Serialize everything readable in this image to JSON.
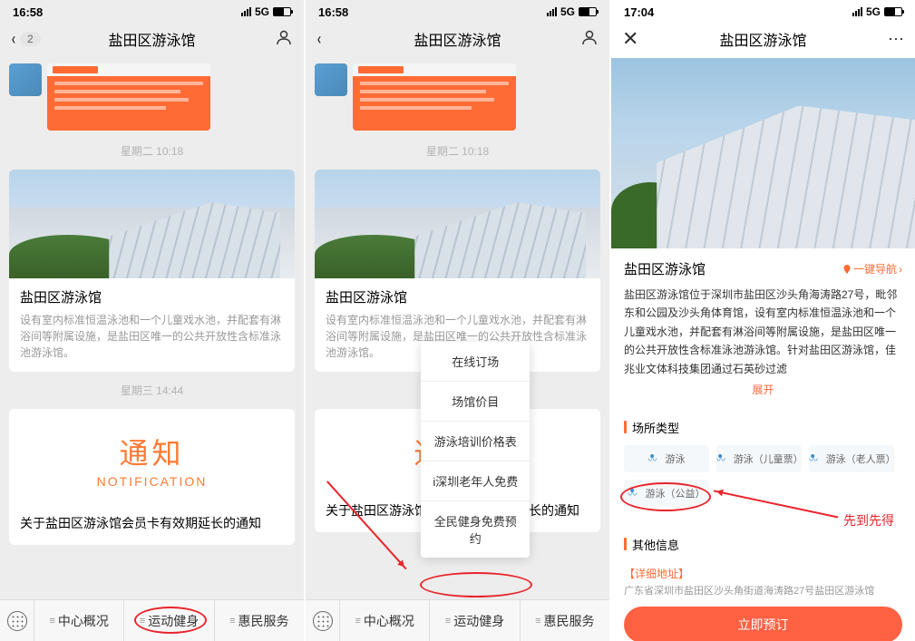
{
  "status": {
    "time1": "16:58",
    "time2": "16:58",
    "time3": "17:04",
    "net": "5G"
  },
  "nav": {
    "title": "盐田区游泳馆",
    "back_count": "2"
  },
  "timestamps": {
    "ts1": "星期二 10:18",
    "ts2": "星期三 14:44"
  },
  "article": {
    "title": "盐田区游泳馆",
    "desc": "设有室内标准恒温泳池和一个儿童戏水池，并配套有淋浴间等附属设施，是盐田区唯一的公共开放性含标准泳池游泳馆。"
  },
  "notice": {
    "cn": "通知",
    "en": "NOTIFICATION",
    "text": "关于盐田区游泳馆会员卡有效期延长的通知"
  },
  "tabs": {
    "t1": "中心概况",
    "t2": "运动健身",
    "t3": "惠民服务"
  },
  "popup": {
    "i1": "在线订场",
    "i2": "场馆价目",
    "i3": "游泳培训价格表",
    "i4": "i深圳老年人免费",
    "i5": "全民健身免费预约"
  },
  "s3": {
    "title": "盐田区游泳馆",
    "navlink": "一键导航",
    "desc": "盐田区游泳馆位于深圳市盐田区沙头角海涛路27号，毗邻东和公园及沙头角体育馆，设有室内标准恒温泳池和一个儿童戏水池，并配套有淋浴间等附属设施，是盐田区唯一的公共开放性含标准泳池游泳馆。针对盐田区游泳馆，佳兆业文体科技集团通过石英砂过滤",
    "expand": "展开",
    "sec1": "场所类型",
    "types": {
      "a": "游泳",
      "b": "游泳（儿童票）",
      "c": "游泳（老人票）",
      "d": "游泳（公益）"
    },
    "sec2": "其他信息",
    "addr_label": "【详细地址】",
    "addr": "广东省深圳市盐田区沙头角街道海涛路27号盐田区游泳馆",
    "book": "立即预订",
    "annot": "先到先得"
  }
}
